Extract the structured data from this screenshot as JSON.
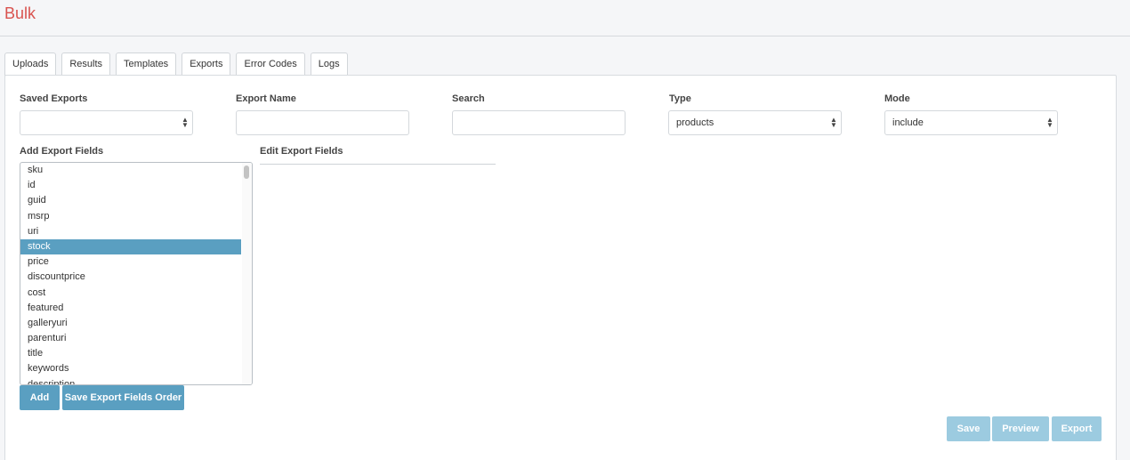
{
  "page": {
    "title": "Bulk"
  },
  "tabs": [
    {
      "label": "Uploads"
    },
    {
      "label": "Results"
    },
    {
      "label": "Templates"
    },
    {
      "label": "Exports"
    },
    {
      "label": "Error Codes"
    },
    {
      "label": "Logs"
    }
  ],
  "form": {
    "saved_exports": {
      "label": "Saved Exports",
      "value": ""
    },
    "export_name": {
      "label": "Export Name",
      "value": ""
    },
    "search": {
      "label": "Search",
      "value": ""
    },
    "type": {
      "label": "Type",
      "value": "products"
    },
    "mode": {
      "label": "Mode",
      "value": "include"
    }
  },
  "add_fields": {
    "label": "Add Export Fields",
    "items": [
      "sku",
      "id",
      "guid",
      "msrp",
      "uri",
      "stock",
      "price",
      "discountprice",
      "cost",
      "featured",
      "galleryuri",
      "parenturi",
      "title",
      "keywords",
      "description"
    ],
    "selected": "stock"
  },
  "edit_fields": {
    "label": "Edit Export Fields"
  },
  "buttons": {
    "add": "Add",
    "save_order": "Save Export Fields Order",
    "save": "Save",
    "preview": "Preview",
    "export": "Export"
  },
  "colors": {
    "accent": "#5a9fc1",
    "title": "#d9534f",
    "disabled": "#9ccbe0"
  },
  "icons": {
    "select_caret": "sort-caret-icon"
  }
}
